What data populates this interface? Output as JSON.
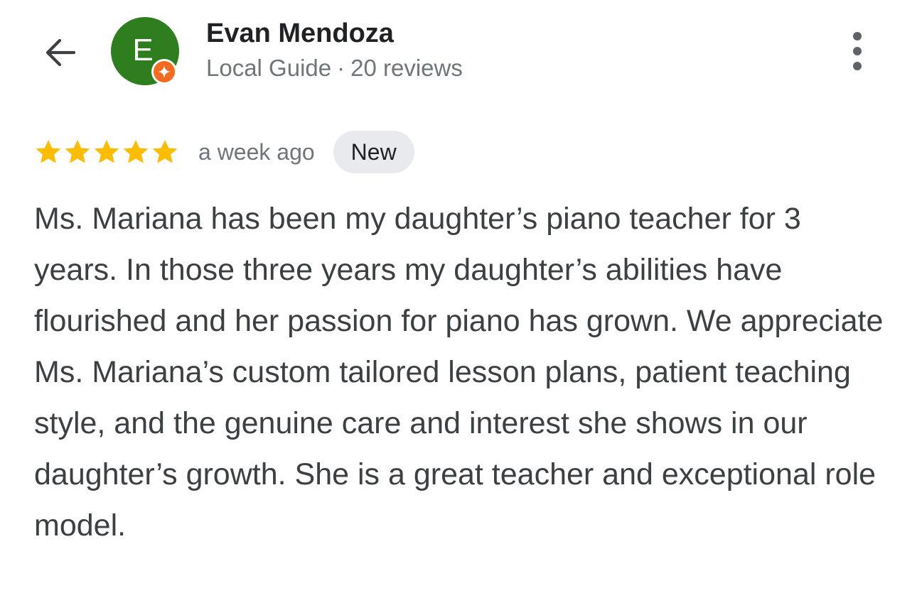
{
  "header": {
    "back_icon": "arrow-back-icon",
    "more_icon": "more-vert-icon"
  },
  "reviewer": {
    "avatar_letter": "E",
    "avatar_color": "#2e7d1e",
    "badge_icon": "local-guide-star-icon",
    "badge_color": "#f26b21",
    "name": "Evan Mendoza",
    "level": "Local Guide",
    "separator": "·",
    "review_count": "20 reviews"
  },
  "review": {
    "rating": 5,
    "max_rating": 5,
    "star_color": "#fbbc04",
    "time": "a week ago",
    "badge": "New",
    "text": "Ms. Mariana has been my daughter’s piano teacher for 3 years. In those three years my daughter’s abilities have flourished and her passion for piano has grown. We appreciate Ms. Mariana’s custom tailored lesson plans, patient teaching style, and the genuine care and interest she shows in our daughter’s growth. She is a great teacher and exceptional role model."
  }
}
